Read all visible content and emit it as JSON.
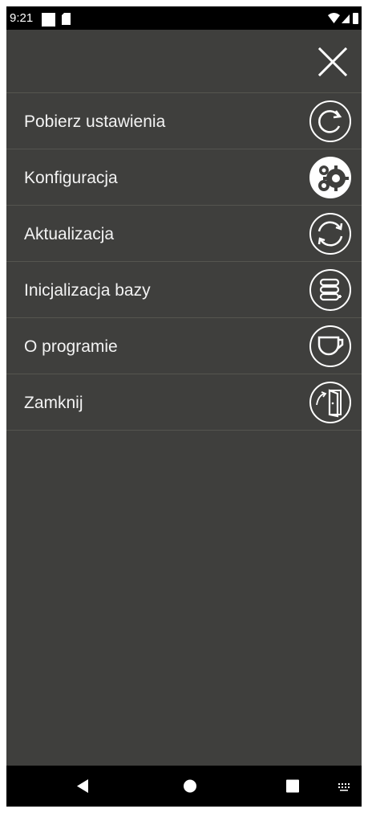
{
  "status_bar": {
    "time": "9:21"
  },
  "menu": {
    "close_icon": "close-icon",
    "items": [
      {
        "label": "Pobierz ustawienia",
        "icon": "refresh-icon"
      },
      {
        "label": "Konfiguracja",
        "icon": "gears-icon"
      },
      {
        "label": "Aktualizacja",
        "icon": "sync-icon"
      },
      {
        "label": "Inicjalizacja bazy",
        "icon": "database-icon"
      },
      {
        "label": "O programie",
        "icon": "cup-icon"
      },
      {
        "label": "Zamknij",
        "icon": "exit-door-icon"
      }
    ]
  },
  "nav_bar": {
    "buttons": [
      "back-icon",
      "home-icon",
      "recents-icon",
      "keyboard-icon"
    ]
  },
  "colors": {
    "background": "#3f3f3d",
    "text": "#f3f3f3",
    "divider": "#55554f",
    "bars": "#000000"
  }
}
